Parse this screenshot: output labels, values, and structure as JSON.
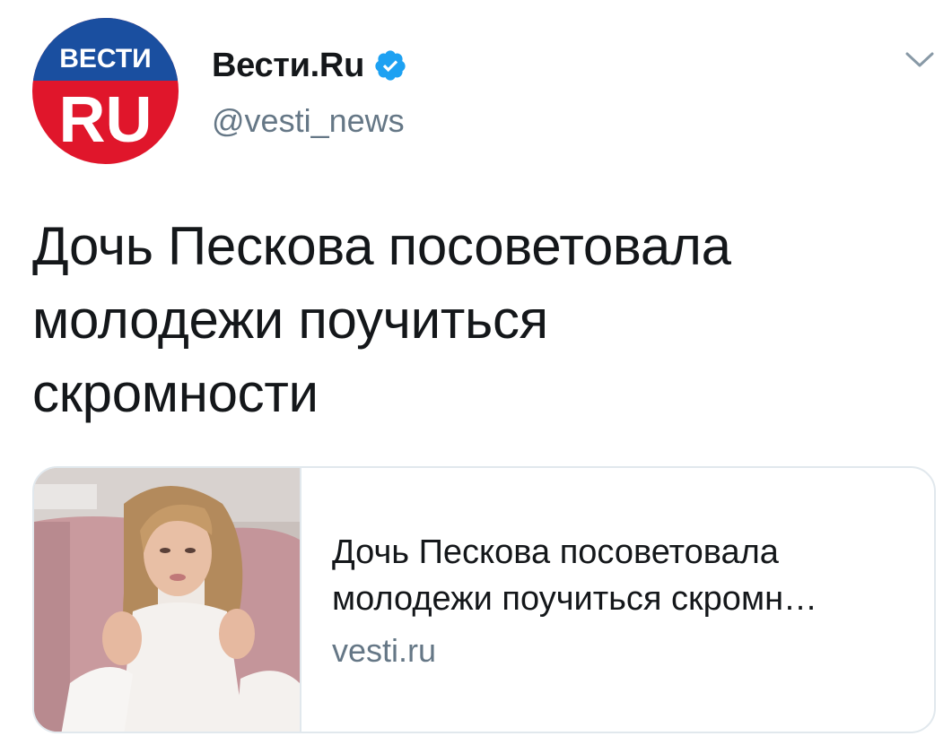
{
  "tweet": {
    "author": {
      "display_name": "Вести.Ru",
      "handle": "@vesti_news",
      "verified": true,
      "avatar_logo_top": "ВЕСТИ",
      "avatar_logo_bottom": "RU"
    },
    "text": "Дочь Пескова посоветовала молодежи поучиться скромности",
    "text_lines": [
      "Дочь Пескова посоветовала",
      "молодежи поучиться",
      "скромности"
    ],
    "card": {
      "title_lines": [
        "Дочь Пескова посоветовала",
        "молодежи поучиться скромн…"
      ],
      "domain": "vesti.ru"
    }
  },
  "colors": {
    "logo_blue": "#1a4fa0",
    "logo_red": "#e0162b",
    "verified_blue": "#1da1f2",
    "secondary_text": "#657786",
    "border": "#e1e8ed"
  },
  "icons": {
    "verified": "verified-badge-icon",
    "caret": "chevron-down-icon"
  }
}
